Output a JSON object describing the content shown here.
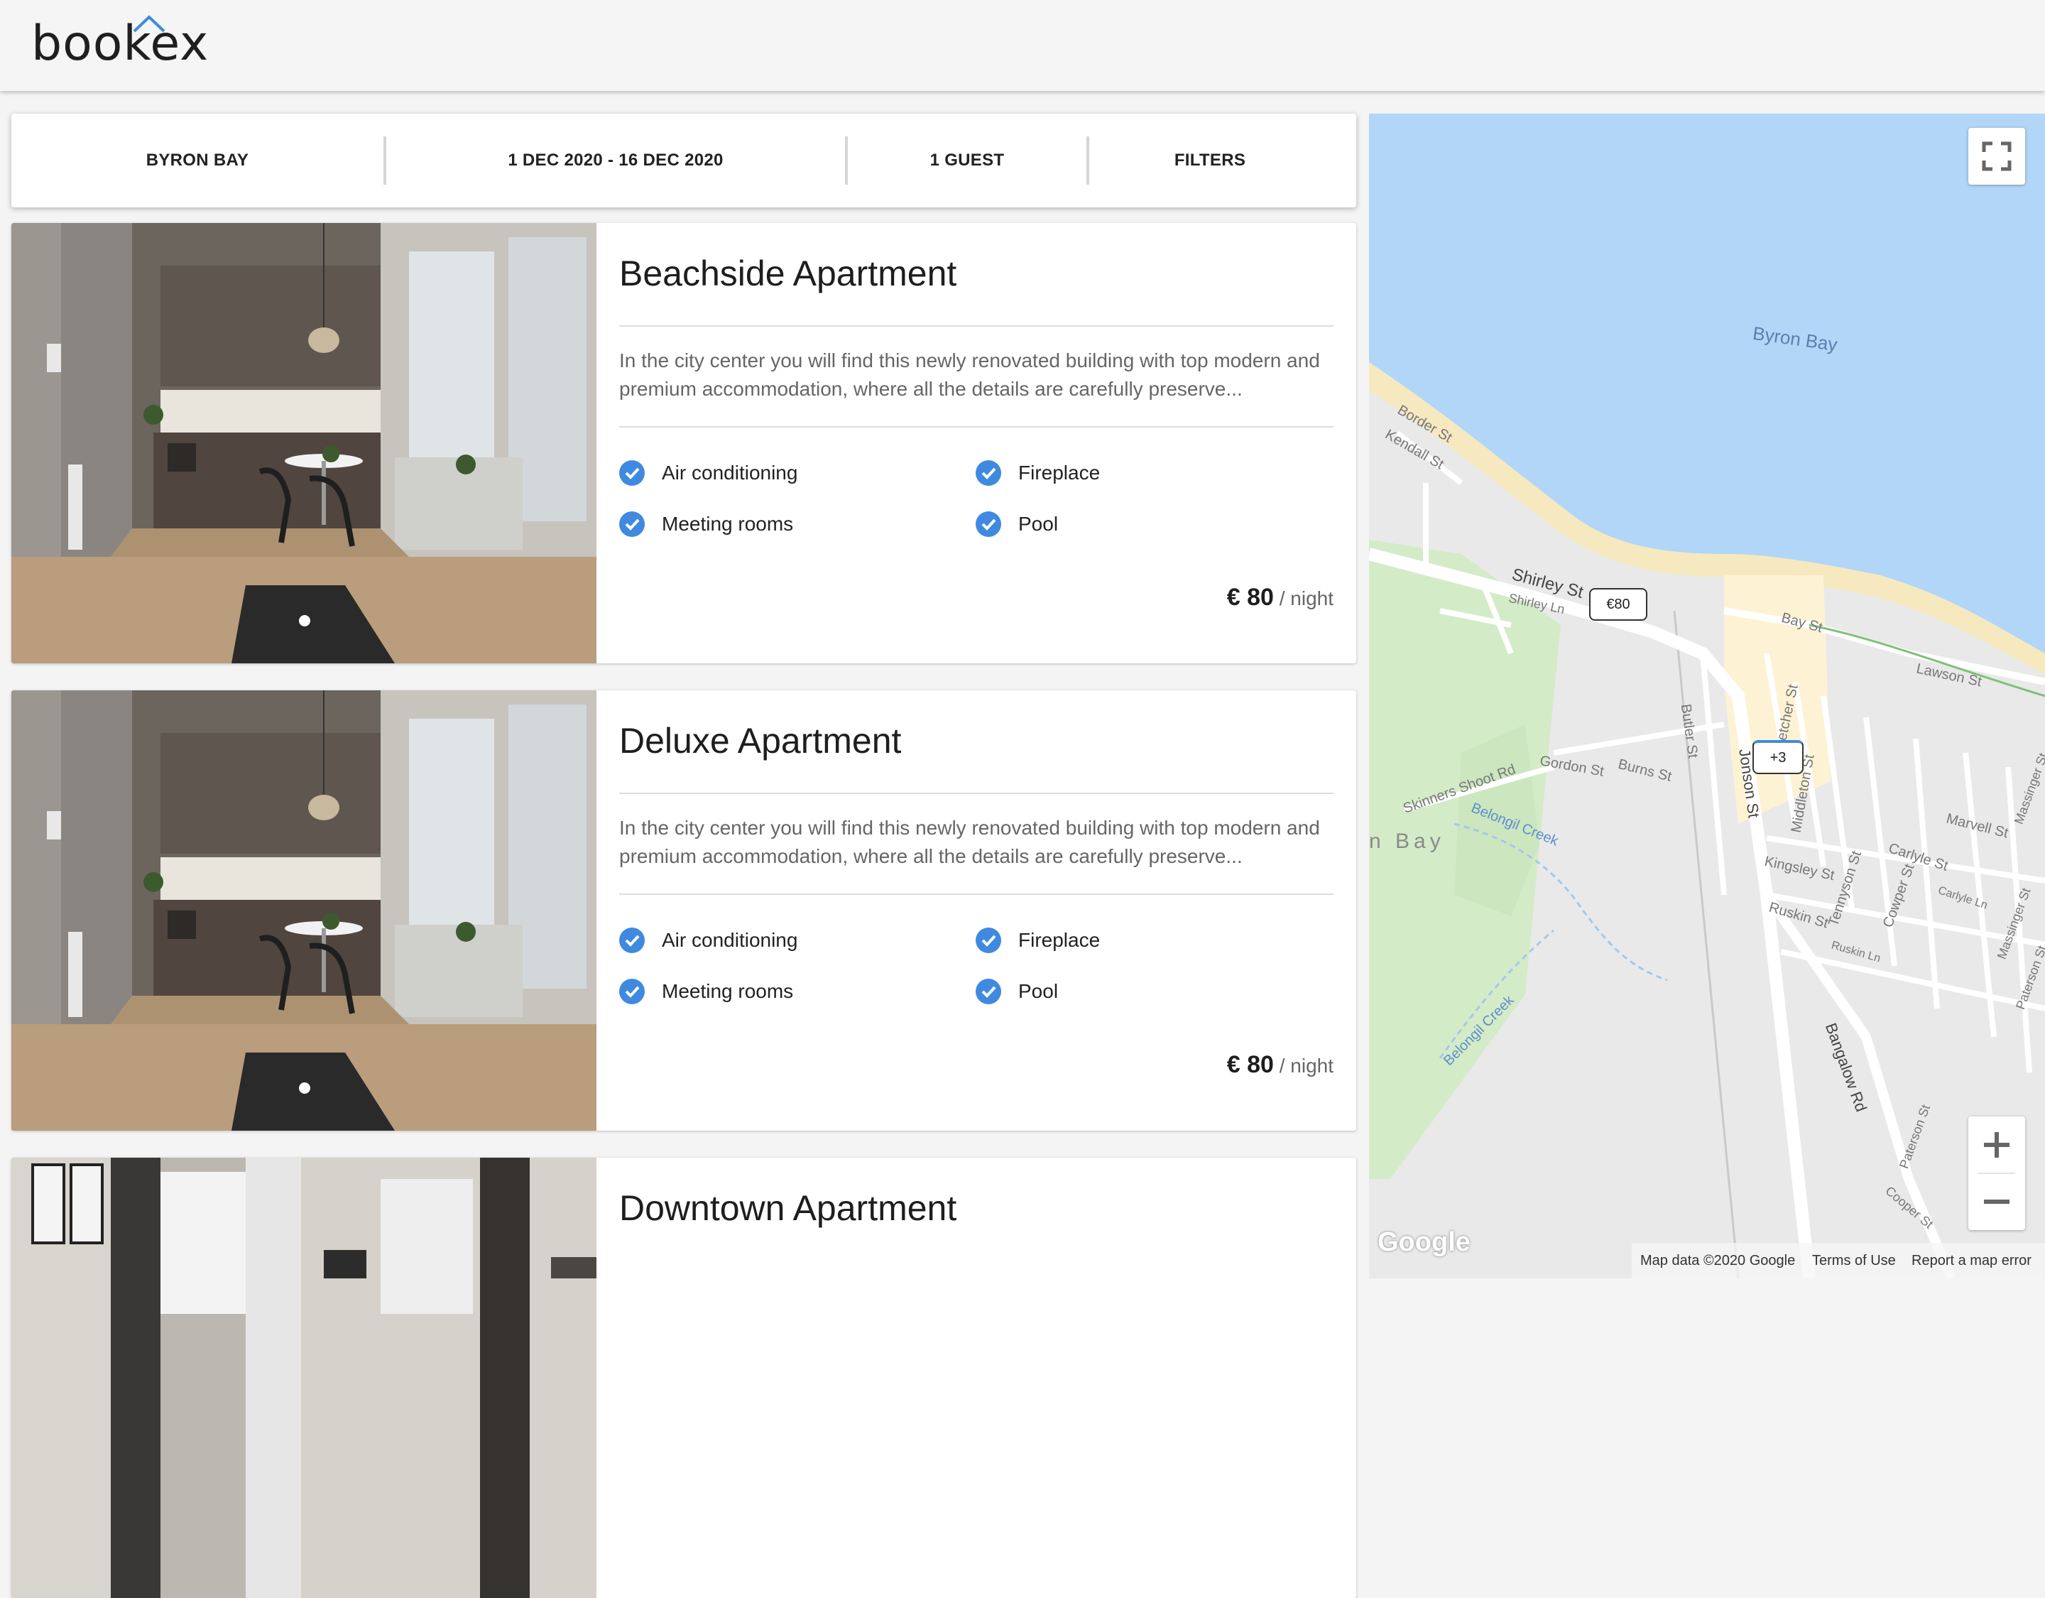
{
  "app": {
    "logo": "bookex"
  },
  "search": {
    "location": "BYRON BAY",
    "dates": "1 DEC 2020 - 16 DEC 2020",
    "guests": "1 GUEST",
    "filters": "FILTERS"
  },
  "listings": [
    {
      "title": "Beachside Apartment",
      "description": "In the city center you will find this newly renovated building with top modern and premium accommodation, where all the details are carefully preserve...",
      "amenities": [
        "Air conditioning",
        "Fireplace",
        "Meeting rooms",
        "Pool"
      ],
      "price": "€ 80",
      "price_unit": "/ night"
    },
    {
      "title": "Deluxe Apartment",
      "description": "In the city center you will find this newly renovated building with top modern and premium accommodation, where all the details are carefully preserve...",
      "amenities": [
        "Air conditioning",
        "Fireplace",
        "Meeting rooms",
        "Pool"
      ],
      "price": "€ 80",
      "price_unit": "/ night"
    },
    {
      "title": "Downtown Apartment"
    }
  ],
  "map": {
    "water_label": "Byron Bay",
    "bay_label_partial": "n Bay",
    "streets": [
      "Border St",
      "Kendall St",
      "Shirley St",
      "Shirley Ln",
      "Bay St",
      "Lawson St",
      "Butler St",
      "Fletcher St",
      "Jonson St",
      "Middleton St",
      "Gordon St",
      "Burns St",
      "Skinners Shoot Rd",
      "Belongil Creek",
      "Belongil Creek",
      "Kingsley St",
      "Tennyson St",
      "Carlyle St",
      "Carlyle Ln",
      "Marvell St",
      "Massinger St",
      "Cowper St",
      "Ruskin St",
      "Ruskin Ln",
      "Massinger St",
      "Paterson St",
      "Bangalow Rd",
      "Paterson St",
      "Cooper St"
    ],
    "markers": [
      "€80",
      "+3"
    ],
    "google": "Google",
    "attribution": "Map data ©2020 Google",
    "terms": "Terms of Use",
    "report": "Report a map error",
    "colors": {
      "water": "#b2d6f7",
      "land": "#e9e9e9",
      "park": "#d4ebc8",
      "sand": "#f6e9bf",
      "town": "#fdf3d4"
    }
  },
  "colors": {
    "accent": "#3f8ae0",
    "background": "#f4f4f4"
  }
}
